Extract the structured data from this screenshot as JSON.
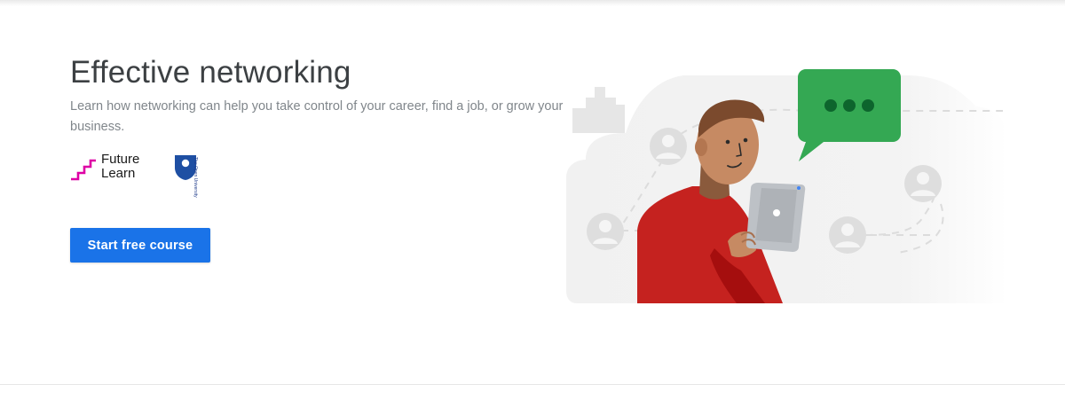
{
  "course": {
    "title": "Effective networking",
    "description": "Learn how networking can help you take control of your career, find a job, or grow your business."
  },
  "partners": {
    "futurelearn": {
      "line1": "Future",
      "line2": "Learn"
    },
    "open_university": {
      "text": "The Open University"
    }
  },
  "cta": {
    "label": "Start free course"
  },
  "colors": {
    "primary_button": "#1a73e8",
    "title_text": "#3c4043",
    "description_text": "#80868b",
    "speech_bubble": "#34a853",
    "shirt": "#c5221f",
    "futurelearn_brand": "#de00a5",
    "open_university_brand": "#1e4fa3"
  },
  "icons": {
    "futurelearn_logo": "staircase-logo",
    "open_university_logo": "shield-logo",
    "chat_bubble": "speech-bubble-icon",
    "contacts": "user-avatar-icon"
  }
}
